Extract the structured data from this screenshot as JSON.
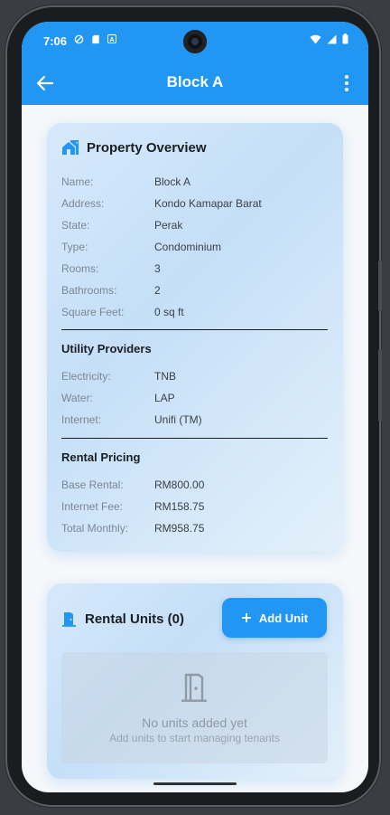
{
  "status_bar": {
    "time": "7:06",
    "left_icons": [
      "vpn-icon",
      "sd-card-icon",
      "app-notification-icon"
    ],
    "right_icons": [
      "wifi-icon",
      "signal-icon",
      "battery-icon"
    ]
  },
  "app_bar": {
    "title": "Block A",
    "back_icon": "arrow-left-icon",
    "menu_icon": "more-vert-icon"
  },
  "overview": {
    "title": "Property Overview",
    "fields": [
      {
        "label": "Name:",
        "value": "Block A"
      },
      {
        "label": "Address:",
        "value": "Kondo Kamapar Barat"
      },
      {
        "label": "State:",
        "value": "Perak"
      },
      {
        "label": "Type:",
        "value": "Condominium"
      },
      {
        "label": "Rooms:",
        "value": "3"
      },
      {
        "label": "Bathrooms:",
        "value": "2"
      },
      {
        "label": "Square Feet:",
        "value": "0 sq ft"
      }
    ],
    "utility_title": "Utility Providers",
    "utilities": [
      {
        "label": "Electricity:",
        "value": "TNB"
      },
      {
        "label": "Water:",
        "value": "LAP"
      },
      {
        "label": "Internet:",
        "value": "Unifi (TM)"
      }
    ],
    "pricing_title": "Rental Pricing",
    "pricing": [
      {
        "label": "Base Rental:",
        "value": "RM800.00"
      },
      {
        "label": "Internet Fee:",
        "value": "RM158.75"
      },
      {
        "label": "Total Monthly:",
        "value": "RM958.75"
      }
    ]
  },
  "units": {
    "title": "Rental Units (0)",
    "add_label": "Add Unit",
    "empty_title": "No units added yet",
    "empty_subtitle": "Add units to start managing tenants"
  },
  "colors": {
    "primary": "#2196f3",
    "card_gradient_start": "#d6e9fb",
    "text_dark": "#1b1f24",
    "text_muted": "#7b8794"
  }
}
